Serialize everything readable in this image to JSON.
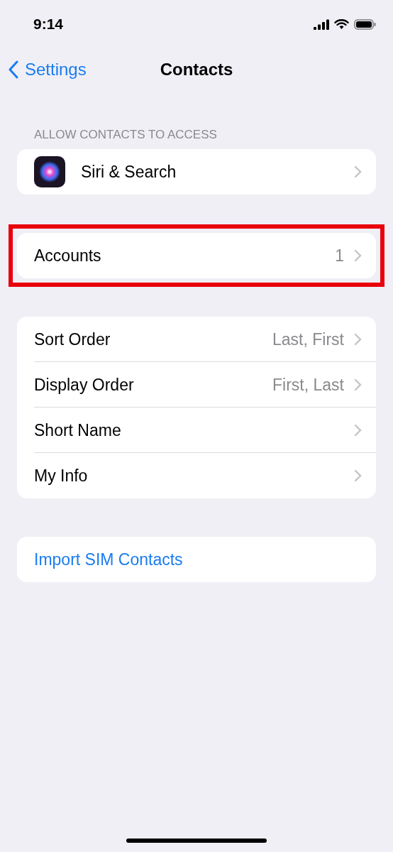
{
  "status_bar": {
    "time": "9:14"
  },
  "nav": {
    "back": "Settings",
    "title": "Contacts"
  },
  "groups": [
    {
      "header": "ALLOW CONTACTS TO ACCESS",
      "highlighted": false,
      "rows": [
        {
          "kind": "app",
          "label": "Siri & Search",
          "chevron": true
        }
      ]
    },
    {
      "highlighted": true,
      "rows": [
        {
          "kind": "value",
          "label": "Accounts",
          "value": "1",
          "chevron": true
        }
      ]
    },
    {
      "highlighted": false,
      "rows": [
        {
          "kind": "value",
          "label": "Sort Order",
          "value": "Last, First",
          "chevron": true
        },
        {
          "kind": "value",
          "label": "Display Order",
          "value": "First, Last",
          "chevron": true
        },
        {
          "kind": "value",
          "label": "Short Name",
          "chevron": true
        },
        {
          "kind": "value",
          "label": "My Info",
          "chevron": true
        }
      ]
    },
    {
      "highlighted": false,
      "rows": [
        {
          "kind": "action",
          "label": "Import SIM Contacts",
          "chevron": false
        }
      ]
    }
  ]
}
